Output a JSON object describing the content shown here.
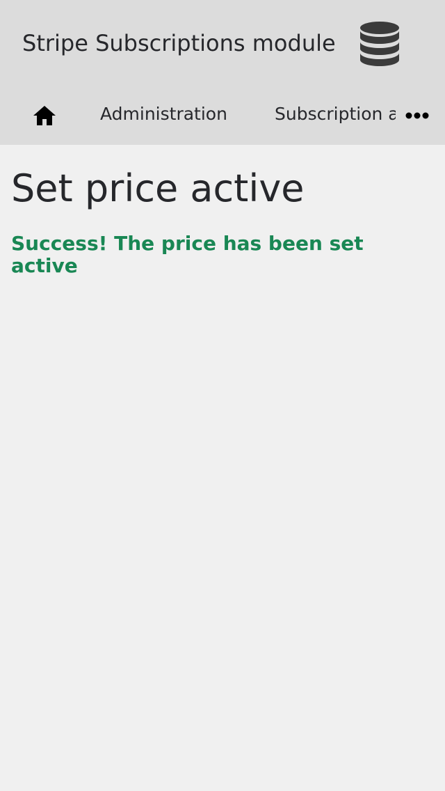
{
  "header": {
    "app_title": "Stripe Subscriptions module",
    "db_icon": "database-icon"
  },
  "nav": {
    "home_icon": "home-icon",
    "items": [
      {
        "label": "Administration"
      },
      {
        "label": "Subscription a"
      }
    ],
    "more_icon": "more-horizontal-icon"
  },
  "main": {
    "title": "Set price active",
    "message": "Success! The price has been set active"
  },
  "colors": {
    "header_bg": "#dcdcdc",
    "page_bg": "#f0f0f0",
    "text": "#26272b",
    "success": "#198754"
  }
}
